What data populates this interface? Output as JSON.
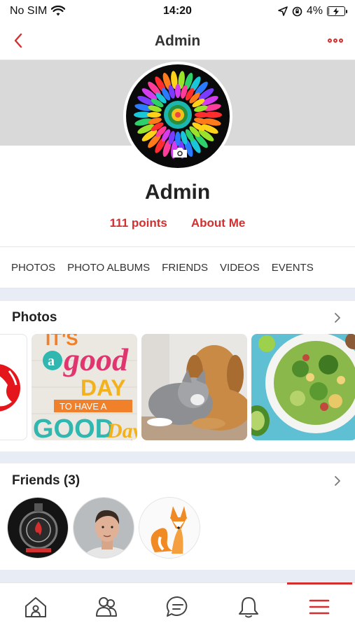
{
  "status_bar": {
    "carrier": "No SIM",
    "time": "14:20",
    "battery": "4%",
    "battery_level": 0.04
  },
  "nav": {
    "title": "Admin"
  },
  "profile": {
    "name": "Admin",
    "points": "111 points",
    "about": "About Me"
  },
  "tabs": [
    "PHOTOS",
    "PHOTO ALBUMS",
    "FRIENDS",
    "VIDEOS",
    "EVENTS"
  ],
  "photos_section": {
    "title": "Photos",
    "good_day_card": {
      "line1": "IT'S",
      "line2": "a",
      "line3": "good",
      "line4": "DAY",
      "line5": "TO HAVE A",
      "line6": "GOOD",
      "line7": "Day"
    }
  },
  "friends_section": {
    "title": "Friends (3)"
  },
  "colors": {
    "accent": "#d32f2f",
    "cover": "#d9d9d9",
    "divider": "#e8edf5"
  },
  "icons": {
    "back": "chevron-left-icon",
    "more": "more-dots-icon",
    "camera": "camera-icon",
    "chevron": "chevron-right-icon",
    "home": "home-icon",
    "groups": "groups-icon",
    "chat": "chat-icon",
    "bell": "bell-icon",
    "menu": "menu-icon"
  }
}
